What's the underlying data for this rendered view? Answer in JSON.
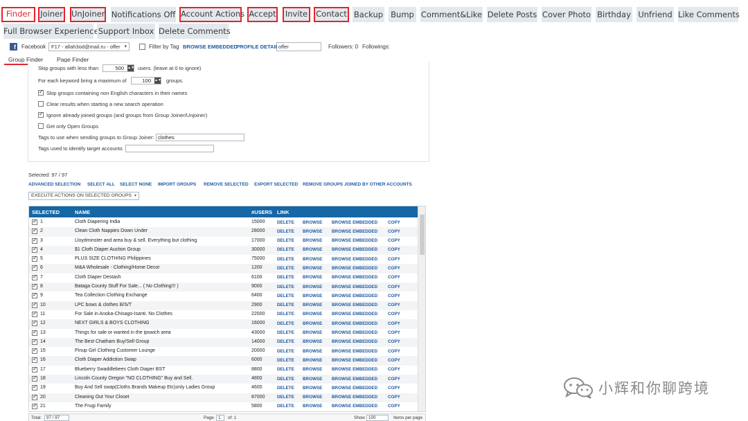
{
  "tabs": [
    {
      "label": "Finder"
    },
    {
      "label": "Joiner"
    },
    {
      "label": "UnJoiner"
    },
    {
      "label": "Notifications Off"
    },
    {
      "label": "Account Actions"
    },
    {
      "label": "Accept"
    },
    {
      "label": "Invite"
    },
    {
      "label": "Contact"
    },
    {
      "label": "Backup"
    },
    {
      "label": "Bump"
    },
    {
      "label": "Comment&Like"
    },
    {
      "label": "Delete Posts"
    },
    {
      "label": "Cover Photo"
    },
    {
      "label": "Birthday"
    },
    {
      "label": "Unfriend"
    },
    {
      "label": "Like Comments"
    },
    {
      "label": "Full Browser Experience"
    },
    {
      "label": "Support Inbox"
    },
    {
      "label": "Delete Comments"
    }
  ],
  "account_row": {
    "network": "Facebook",
    "account": "F17 - allah3od@mail.ru - offer",
    "filter_by_tag": "Filter by Tag",
    "browse_embedded": "BROWSE EMBEDDED",
    "profile_details": "PROFILE DETAILS",
    "profile_value": "offer",
    "followers": "Followers: 0",
    "followings": "Followings:"
  },
  "subtabs": {
    "group_finder": "Group Finder",
    "page_finder": "Page Finder"
  },
  "options": {
    "skip_less_than": "Skip groups with less than",
    "skip_value": "500",
    "skip_suffix": "users. (leave at 0 to ignore)",
    "bring_max": "For each keyword bring a maximum of",
    "bring_value": "100",
    "bring_suffix": "groups.",
    "skip_non_english": "Skip groups containing non English characters in their names",
    "clear_results": "Clear results when starting a new search operation",
    "ignore_joined": "Ignore already joined groups (and groups from Group Joiner/Unjoiner)",
    "open_only": "Get only Open Groups",
    "tags_joiner_label": "Tags to use when sending groups to Group Joiner:",
    "tags_joiner_value": "clothes",
    "tags_target_label": "Tags used to identify target accounts"
  },
  "selected_count": "Selected: 97 / 97",
  "actions": [
    "ADVANCED SELECTION",
    "SELECT ALL",
    "SELECT NONE",
    "IMPORT GROUPS",
    "REMOVE SELECTED",
    "EXPORT SELECTED",
    "REMOVE GROUPS JOINED BY OTHER ACCOUNTS"
  ],
  "execute_actions": "EXECUTE ACTIONS ON SELECTED GROUPS",
  "table": {
    "headers": {
      "selected": "SELECTED",
      "name": "NAME",
      "users": "#USERS",
      "link": "LINK"
    },
    "row_links": {
      "delete": "DELETE",
      "browse": "BROWSE",
      "browse_embedded": "BROWSE EMBEDDED",
      "copy": "COPY"
    },
    "rows": [
      {
        "n": "1",
        "name": "Cloth Diapering India",
        "users": "15000"
      },
      {
        "n": "2",
        "name": "Clean Cloth Nappies Down Under",
        "users": "28000"
      },
      {
        "n": "3",
        "name": "Lloydminster and area buy & sell. Everything but clothing",
        "users": "17000"
      },
      {
        "n": "4",
        "name": "$1 Cloth Diaper Auction Group",
        "users": "30000"
      },
      {
        "n": "5",
        "name": "PLUS SIZE CLOTHING Philippines",
        "users": "75000"
      },
      {
        "n": "6",
        "name": "M&A Wholesale - Clothing/Home Decor",
        "users": "1200"
      },
      {
        "n": "7",
        "name": "Cloth Diaper Destash",
        "users": "6100"
      },
      {
        "n": "8",
        "name": "Bataga County Stuff For Sale... ( No Clothing!!! )",
        "users": "9000"
      },
      {
        "n": "9",
        "name": "Tea Collection Clothing Exchange",
        "users": "6400"
      },
      {
        "n": "10",
        "name": "LPC bows & clothes B/S/T",
        "users": "2900"
      },
      {
        "n": "11",
        "name": "For Sale in Anoka-Chisago-Isanti.     No Clothes",
        "users": "22000"
      },
      {
        "n": "12",
        "name": "NEXT GIRLS & BOYS CLOTHING",
        "users": "16000"
      },
      {
        "n": "13",
        "name": "Things for sale or wanted in the ipswich area",
        "users": "43000"
      },
      {
        "n": "14",
        "name": "The Best Chatham Buy/Sell Group",
        "users": "14000"
      },
      {
        "n": "15",
        "name": "Pinup Girl Clothing Customer Lounge",
        "users": "20000"
      },
      {
        "n": "16",
        "name": "Cloth Diaper Addiction Swap",
        "users": "6000"
      },
      {
        "n": "17",
        "name": "Blueberry Swaddlebees Cloth Diaper BST",
        "users": "8800"
      },
      {
        "n": "18",
        "name": "Lincoln County Oregon  \"NO CLOTHING\"  Buy and Sell.",
        "users": "4800"
      },
      {
        "n": "19",
        "name": "Buy And Sell swap(Cloths Brands Makeup Etc)only Ladies Group",
        "users": "4600"
      },
      {
        "n": "20",
        "name": "Cleaning Out Your Closet",
        "users": "87000"
      },
      {
        "n": "21",
        "name": "The Frugi Family",
        "users": "5800"
      }
    ]
  },
  "footer": {
    "total_label": "Total:",
    "total_value": "97 / 97",
    "page_label": "Page",
    "page_value": "1",
    "of_label": "of: 1",
    "show_label": "Show",
    "show_value": "100",
    "items_per_page": "Items per page"
  },
  "watermark": "小辉和你聊跨境",
  "colors": {
    "accent_red": "#e5222b",
    "header_blue": "#1567a6",
    "link_blue": "#1f5aa0"
  }
}
